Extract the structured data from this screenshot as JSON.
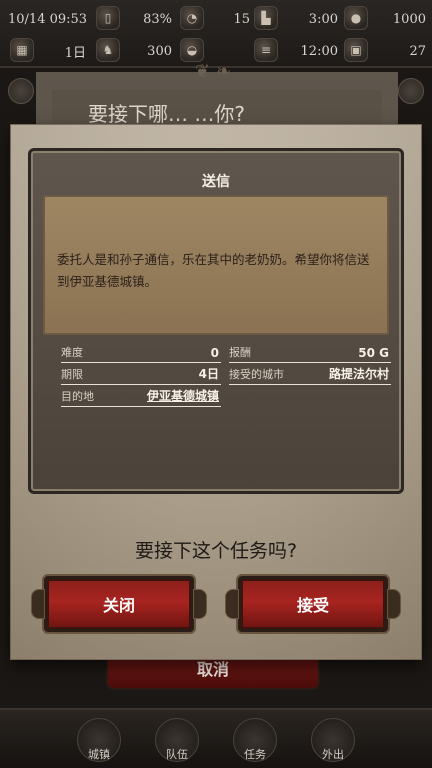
{
  "status_bar": {
    "datetime": "10/14 09:53",
    "percent": "83%",
    "count": "15",
    "time1": "3:00",
    "value1": "1000",
    "day": "1日",
    "value2": "300",
    "time2": "12:00",
    "value3": "27",
    "icons": [
      "phone-icon",
      "battery-icon",
      "stamina-icon",
      "scroll-icon",
      "coin-stack-icon",
      "rabbit-icon",
      "gold-pot-icon",
      "contract-icon",
      "chest-icon"
    ]
  },
  "background": {
    "title": "要接下哪… …你?",
    "cancel_label": "取消"
  },
  "bottom_nav": [
    {
      "label": "城镇"
    },
    {
      "label": "队伍"
    },
    {
      "label": "任务"
    },
    {
      "label": "外出"
    }
  ],
  "dialog": {
    "quest_title": "送信",
    "description": "委托人是和孙子通信，乐在其中的老奶奶。希望你将信送到伊亚基德城镇。",
    "fields": {
      "difficulty_label": "难度",
      "difficulty_value": "0",
      "reward_label": "报酬",
      "reward_value": "50 G",
      "deadline_label": "期限",
      "deadline_value": "4日",
      "accept_city_label": "接受的城市",
      "accept_city_value": "路提法尔村",
      "destination_label": "目的地",
      "destination_value": "伊亚基德城镇"
    },
    "prompt": "要接下这个任务吗?",
    "close_label": "关闭",
    "accept_label": "接受"
  }
}
